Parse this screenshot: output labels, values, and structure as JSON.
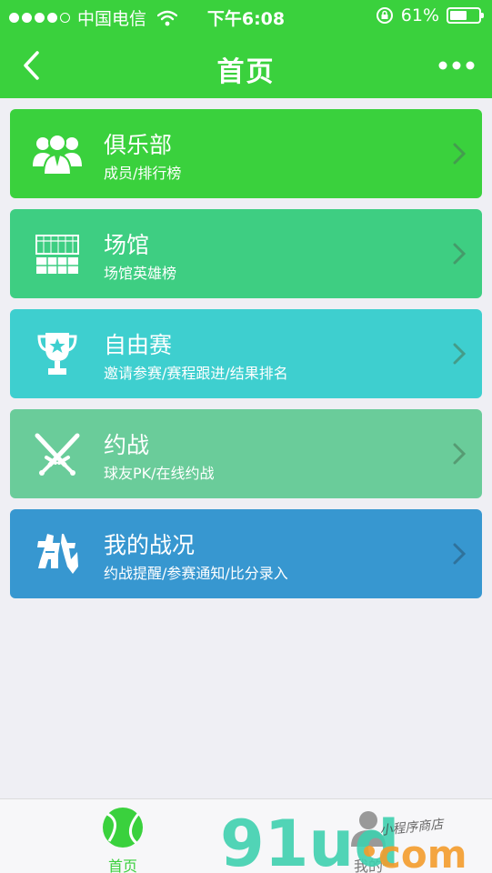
{
  "status_bar": {
    "carrier": "中国电信",
    "time": "下午6:08",
    "battery": "61%",
    "battery_level": 0.61
  },
  "nav": {
    "title": "首页"
  },
  "menu": [
    {
      "title": "俱乐部",
      "subtitle": "成员/排行榜",
      "color": "#3ad13d",
      "icon": "club-members-icon"
    },
    {
      "title": "场馆",
      "subtitle": "场馆英雄榜",
      "color": "#3ece82",
      "icon": "venue-icon"
    },
    {
      "title": "自由赛",
      "subtitle": "邀请参赛/赛程跟进/结果排名",
      "color": "#3ecfcf",
      "icon": "trophy-icon"
    },
    {
      "title": "约战",
      "subtitle": "球友PK/在线约战",
      "color": "#6acc9a",
      "icon": "crossed-swords-icon"
    },
    {
      "title": "我的战况",
      "subtitle": "约战提醒/参赛通知/比分录入",
      "color": "#3797d0",
      "icon": "battle-character-icon"
    }
  ],
  "tabbar": {
    "home_label": "首页",
    "mine_label": "我的"
  },
  "watermark": {
    "brand": "91ud",
    "domain": "com",
    "tagline": "小程序商店"
  }
}
